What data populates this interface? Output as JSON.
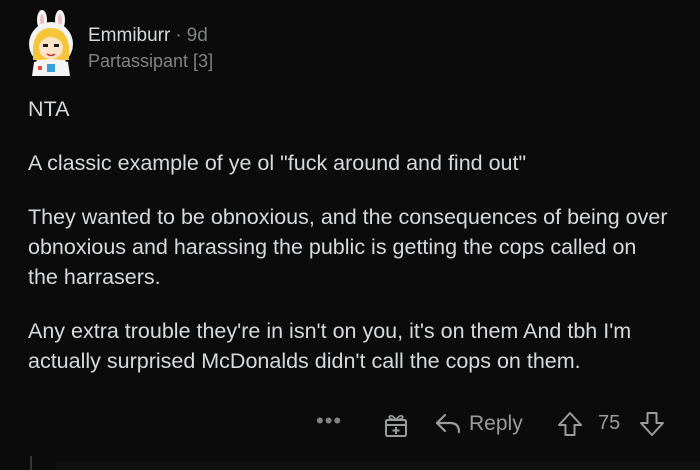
{
  "comment": {
    "username": "Emmiburr",
    "separator": "·",
    "age": "9d",
    "flair": "Partassipant [3]",
    "paragraphs": [
      "NTA",
      "A classic example of ye ol \"fuck around and find out\"",
      "They wanted to be obnoxious, and the consequences of being over obnoxious and harassing the public is getting the cops called on the harrasers.",
      "Any extra trouble they're in isn't on you, it's on them And tbh I'm actually surprised McDonalds didn't call the cops on them."
    ]
  },
  "actions": {
    "more_label": "•••",
    "reply_label": "Reply",
    "score": "75"
  },
  "icons": {
    "avatar": "avatar-icon",
    "more": "more-options-icon",
    "award": "award-icon",
    "reply": "reply-arrow-icon",
    "upvote": "upvote-arrow-icon",
    "downvote": "downvote-arrow-icon"
  },
  "colors": {
    "background": "#0b0b0b",
    "text": "#d7dadc",
    "muted": "#818384"
  }
}
